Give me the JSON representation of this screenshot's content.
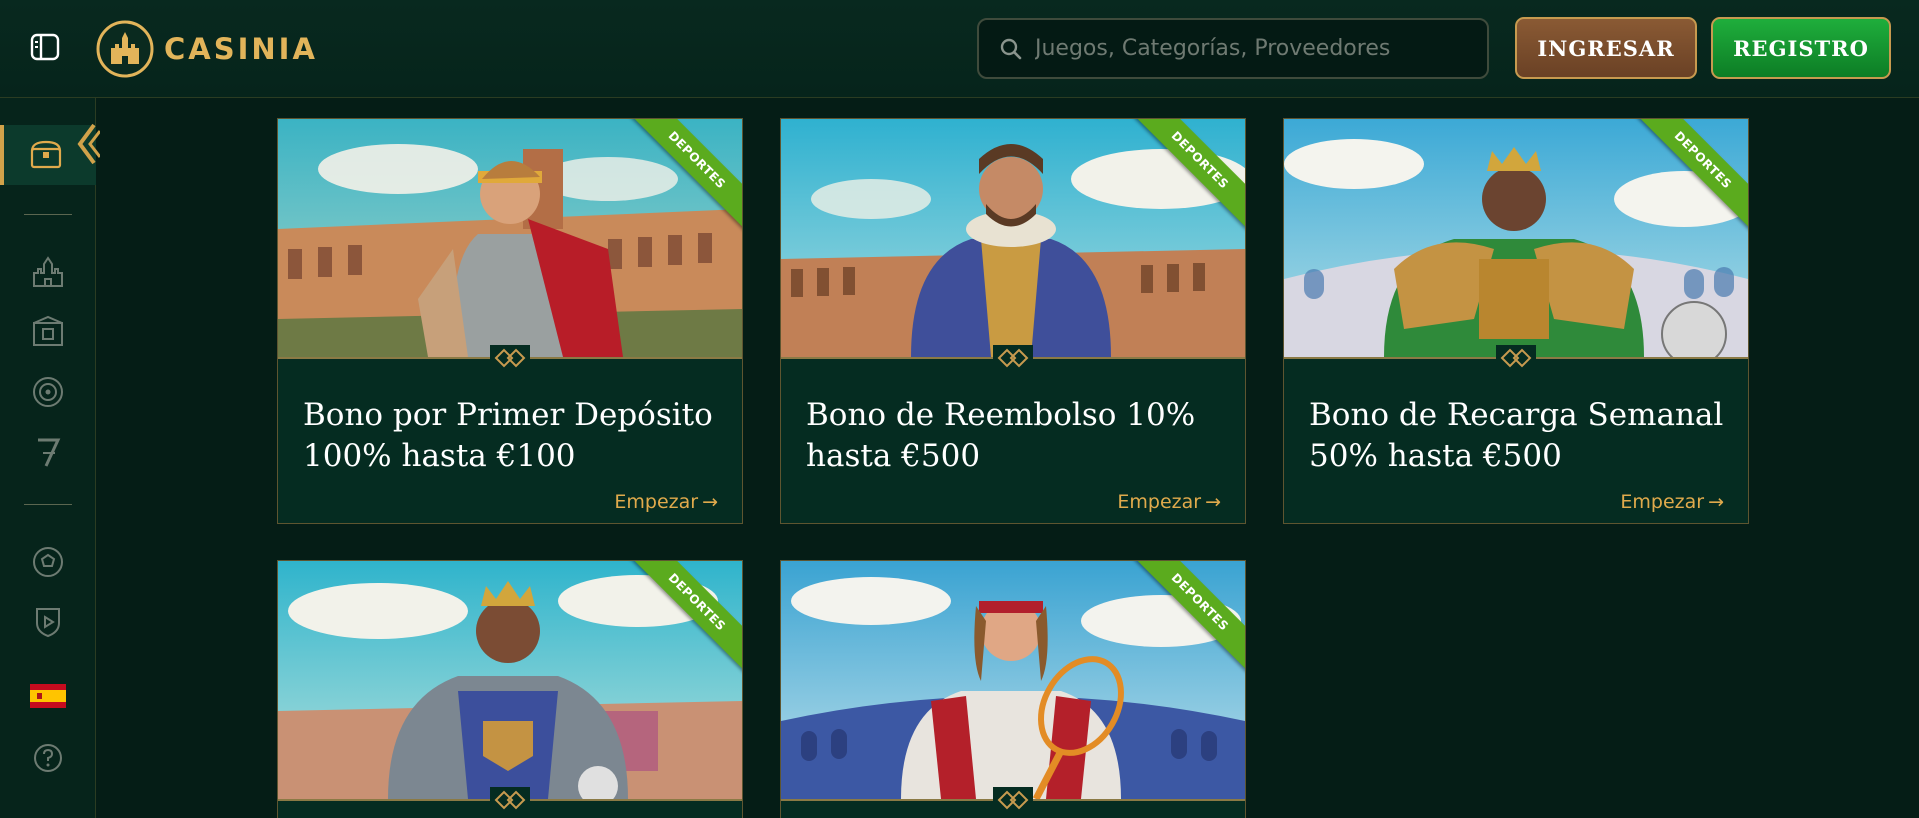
{
  "header": {
    "logo_text": "CASINIA",
    "search_placeholder": "Juegos, Categorías, Proveedores",
    "login_label": "INGRESAR",
    "register_label": "REGISTRO"
  },
  "sidebar": {
    "items": [
      {
        "name": "promotions",
        "icon": "treasure-chest-icon",
        "active": true
      },
      {
        "name": "casino",
        "icon": "castle-icon"
      },
      {
        "name": "live-casino",
        "icon": "theater-icon"
      },
      {
        "name": "roulette",
        "icon": "roulette-icon"
      },
      {
        "name": "slots",
        "icon": "seven-icon"
      },
      {
        "name": "sports",
        "icon": "soccer-ball-icon"
      },
      {
        "name": "virtual-sports",
        "icon": "shield-play-icon"
      },
      {
        "name": "language",
        "icon": "spain-flag-icon"
      },
      {
        "name": "help",
        "icon": "question-icon"
      }
    ]
  },
  "cards": [
    {
      "title": "Bono por Primer Depósito 100% hasta €100",
      "link": "Empezar",
      "ribbon": "DEPORTES"
    },
    {
      "title": "Bono de Reembolso 10% hasta €500",
      "link": "Empezar",
      "ribbon": "DEPORTES"
    },
    {
      "title": "Bono de Recarga Semanal 50% hasta €500",
      "link": "Empezar",
      "ribbon": "DEPORTES"
    },
    {
      "title": "",
      "link": "",
      "ribbon": "DEPORTES"
    },
    {
      "title": "",
      "link": "",
      "ribbon": "DEPORTES"
    }
  ],
  "colors": {
    "background": "#051d16",
    "gold": "#e0aa4c",
    "ribbon_green": "#5bab1e",
    "register_green": "#1fae3c",
    "login_brown": "#7a4d2c"
  }
}
